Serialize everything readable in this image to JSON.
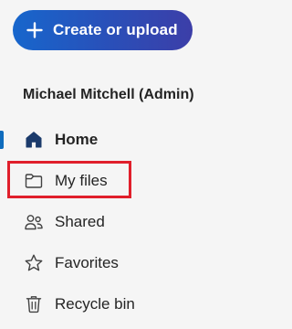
{
  "create_button": {
    "label": "Create or upload",
    "icon": "plus-icon"
  },
  "account": {
    "name": "Michael Mitchell (Admin)"
  },
  "nav": {
    "items": [
      {
        "label": "Home",
        "icon": "home-icon",
        "active": true
      },
      {
        "label": "My files",
        "icon": "folder-icon",
        "active": false,
        "highlighted": true
      },
      {
        "label": "Shared",
        "icon": "people-icon",
        "active": false
      },
      {
        "label": "Favorites",
        "icon": "star-icon",
        "active": false
      },
      {
        "label": "Recycle bin",
        "icon": "trash-icon",
        "active": false
      }
    ]
  },
  "colors": {
    "accent": "#0f6cbd",
    "button_gradient_start": "#1766cc",
    "button_gradient_end": "#3c3ea8",
    "highlight": "#e01f2b",
    "text": "#242424",
    "background": "#f5f5f5"
  }
}
